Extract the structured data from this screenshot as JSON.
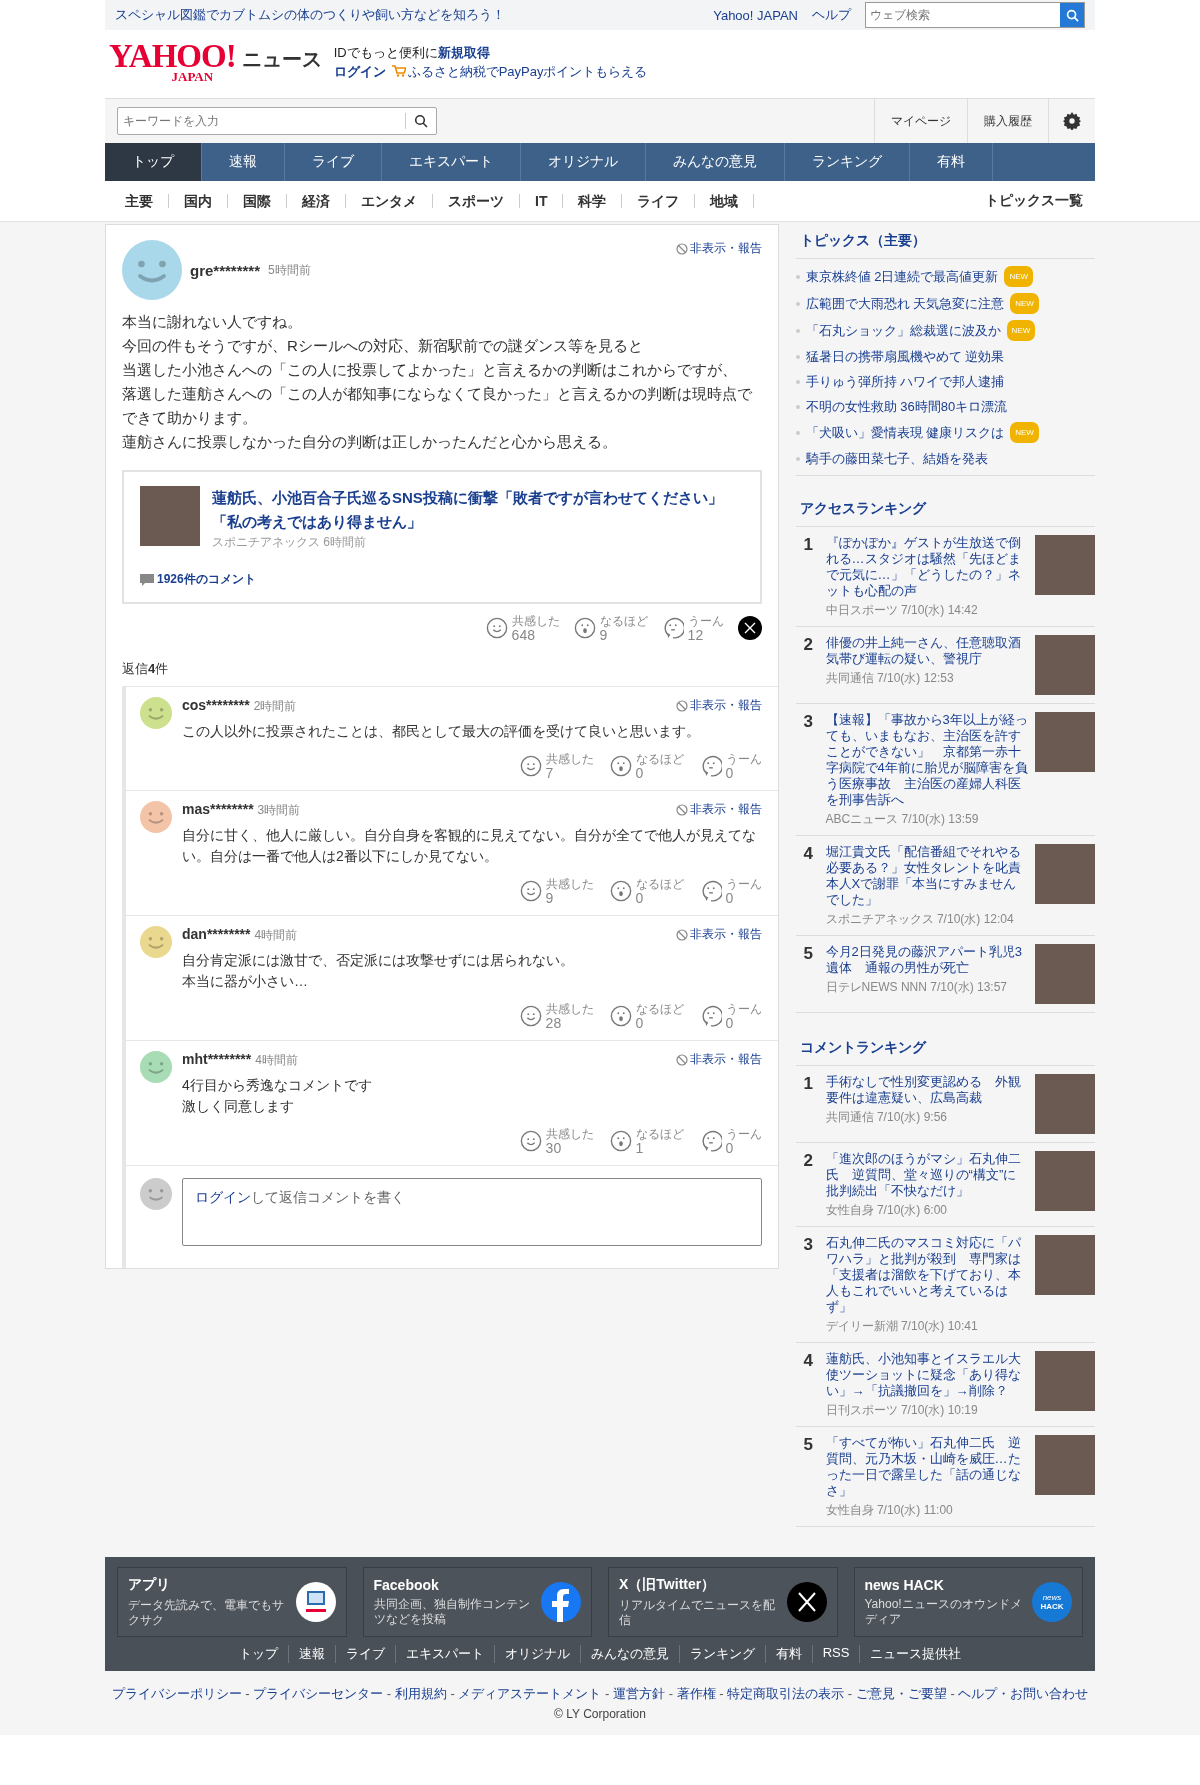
{
  "promo": "スペシャル図鑑でカブトムシの体のつくりや飼い方などを知ろう！",
  "header_links": [
    "Yahoo! JAPAN",
    "ヘルプ"
  ],
  "web_search": {
    "placeholder": "ウェブ検索"
  },
  "logo": {
    "main": "YAHOO!",
    "sub": "JAPAN"
  },
  "site_name": "ニュース",
  "id_promo": {
    "text": "IDでもっと便利に",
    "link": "新規取得"
  },
  "login": "ログイン",
  "furusato": "ふるさと納税でPayPayポイントもらえる",
  "search": {
    "placeholder": "キーワードを入力"
  },
  "user_links": [
    "マイページ",
    "購入履歴"
  ],
  "nav_tabs": [
    {
      "label": "トップ",
      "selected": true
    },
    {
      "label": "速報",
      "selected": false
    },
    {
      "label": "ライブ",
      "selected": false
    },
    {
      "label": "エキスパート",
      "selected": false
    },
    {
      "label": "オリジナル",
      "selected": false
    },
    {
      "label": "みんなの意見",
      "selected": false
    },
    {
      "label": "ランキング",
      "selected": false
    },
    {
      "label": "有料",
      "selected": false
    }
  ],
  "categories": [
    "主要",
    "国内",
    "国際",
    "経済",
    "エンタメ",
    "スポーツ",
    "IT",
    "科学",
    "ライフ",
    "地域"
  ],
  "topics_list_link": "トピックス一覧",
  "comment": {
    "user": "gre********",
    "time": "5時間前",
    "color": "#a8d8ea",
    "action": "非表示・報告",
    "body": [
      "本当に謝れない人ですね。",
      "今回の件もそうですが、Rシールへの対応、新宿駅前での謎ダンス等を見ると",
      "当選した小池さんへの「この人に投票してよかった」と言えるかの判断はこれからですが、",
      "落選した蓮舫さんへの「この人が都知事にならなくて良かった」と言えるかの判断は現時点でできて助かります。",
      "蓮舫さんに投票しなかった自分の判断は正しかったんだと心から思える。"
    ],
    "article": {
      "title": "蓮舫氏、小池百合子氏巡るSNS投稿に衝撃「敗者ですが言わせてください」「私の考えではあり得ません」",
      "source": "スポニチアネックス",
      "time": "6時間前",
      "comments": "1926件のコメント"
    },
    "reactions": [
      {
        "kind": "smile",
        "label": "共感した",
        "count": "648"
      },
      {
        "kind": "surprised",
        "label": "なるほど",
        "count": "9"
      },
      {
        "kind": "thinking",
        "label": "うーん",
        "count": "12"
      }
    ]
  },
  "replies_label": "返信**4**件",
  "replies": [
    {
      "user": "cos********",
      "time": "2時間前",
      "color": "#cde08e",
      "action": "非表示・報告",
      "body": [
        "この人以外に投票されたことは、都民として最大の評価を受けて良いと思います。"
      ],
      "reactions": [
        {
          "kind": "smile",
          "label": "共感した",
          "count": "7"
        },
        {
          "kind": "surprised",
          "label": "なるほど",
          "count": "0"
        },
        {
          "kind": "thinking",
          "label": "うーん",
          "count": "0"
        }
      ]
    },
    {
      "user": "mas********",
      "time": "3時間前",
      "color": "#f3c4a8",
      "action": "非表示・報告",
      "body": [
        "自分に甘く、他人に厳しい。自分自身を客観的に見えてない。自分が全てで他人が見えてない。自分は一番で他人は2番以下にしか見てない。"
      ],
      "reactions": [
        {
          "kind": "smile",
          "label": "共感した",
          "count": "9"
        },
        {
          "kind": "surprised",
          "label": "なるほど",
          "count": "0"
        },
        {
          "kind": "thinking",
          "label": "うーん",
          "count": "0"
        }
      ]
    },
    {
      "user": "dan********",
      "time": "4時間前",
      "color": "#ead88e",
      "action": "非表示・報告",
      "body": [
        "自分肯定派には激甘で、否定派には攻撃せずには居られない。",
        "本当に器が小さい…"
      ],
      "reactions": [
        {
          "kind": "smile",
          "label": "共感した",
          "count": "28"
        },
        {
          "kind": "surprised",
          "label": "なるほど",
          "count": "0"
        },
        {
          "kind": "thinking",
          "label": "うーん",
          "count": "0"
        }
      ]
    },
    {
      "user": "mht********",
      "time": "4時間前",
      "color": "#a8dcb4",
      "action": "非表示・報告",
      "body": [
        "4行目から秀逸なコメントです",
        "激しく同意します"
      ],
      "reactions": [
        {
          "kind": "smile",
          "label": "共感した",
          "count": "30"
        },
        {
          "kind": "surprised",
          "label": "なるほど",
          "count": "1"
        },
        {
          "kind": "thinking",
          "label": "うーん",
          "count": "0"
        }
      ]
    }
  ],
  "reply_box": {
    "link": "ログイン",
    "text": "して返信コメントを書く"
  },
  "topics": {
    "title": "トピックス（主要）",
    "items": [
      {
        "title": "東京株終値 2日連続で最高値更新",
        "badge": "NEW"
      },
      {
        "title": "広範囲で大雨恐れ 天気急変に注意",
        "badge": "NEW"
      },
      {
        "title": "「石丸ショック」総裁選に波及か",
        "badge": "NEW"
      },
      {
        "title": "猛暑日の携帯扇風機やめて 逆効果"
      },
      {
        "title": "手りゅう弾所持 ハワイで邦人逮捕"
      },
      {
        "title": "不明の女性救助 36時間80キロ漂流"
      },
      {
        "title": "「犬吸い」愛情表現 健康リスクは",
        "badge": "NEW"
      },
      {
        "title": "騎手の藤田菜七子、結婚を発表"
      }
    ]
  },
  "access_ranking": {
    "title": "アクセスランキング",
    "items": [
      {
        "rank": "1",
        "title": "『ぽかぽか』ゲストが生放送で倒れる…スタジオは騒然「先ほどまで元気に…」「どうしたの？」ネットも心配の声",
        "source": "中日スポーツ 7/10(水) 14:42"
      },
      {
        "rank": "2",
        "title": "俳優の井上純一さん、任意聴取酒気帯び運転の疑い、警視庁",
        "source": "共同通信 7/10(水) 12:53"
      },
      {
        "rank": "3",
        "title": "【速報】「事故から3年以上が経っても、いまもなお、主治医を許すことができない」　京都第一赤十字病院で4年前に胎児が脳障害を負う医療事故　主治医の産婦人科医を刑事告訴へ",
        "source": "ABCニュース 7/10(水) 13:59"
      },
      {
        "rank": "4",
        "title": "堀江貴文氏「配信番組でそれやる必要ある？」女性タレントを叱責本人Xで謝罪「本当にすみませんでした」",
        "source": "スポニチアネックス 7/10(水) 12:04"
      },
      {
        "rank": "5",
        "title": "今月2日発見の藤沢アパート乳児3遺体　通報の男性が死亡",
        "source": "日テレNEWS NNN 7/10(水) 13:57"
      }
    ]
  },
  "comment_ranking": {
    "title": "コメントランキング",
    "items": [
      {
        "rank": "1",
        "title": "手術なしで性別変更認める　外観要件は違憲疑い、広島高裁",
        "source": "共同通信 7/10(水) 9:56"
      },
      {
        "rank": "2",
        "title": "「進次郎のほうがマシ」石丸伸二氏　逆質問、堂々巡りの“構文”に批判続出「不快なだけ」",
        "source": "女性自身 7/10(水) 6:00"
      },
      {
        "rank": "3",
        "title": "石丸伸二氏のマスコミ対応に「パワハラ」と批判が殺到　専門家は「支援者は溜飲を下げており、本人もこれでいいと考えているはず」",
        "source": "デイリー新潮 7/10(水) 10:41"
      },
      {
        "rank": "4",
        "title": "蓮舫氏、小池知事とイスラエル大使ツーショットに疑念「あり得ない」→「抗議撤回を」→削除？",
        "source": "日刊スポーツ 7/10(水) 10:19"
      },
      {
        "rank": "5",
        "title": "「すべてが怖い」石丸伸二氏　逆質問、元乃木坂・山崎を威圧…たった一日で露呈した「話の通じなさ」",
        "source": "女性自身 7/10(水) 11:00"
      }
    ]
  },
  "footer_cards": [
    {
      "kind": "app",
      "title": "アプリ",
      "text": "データ先読みで、電車でもサクサク"
    },
    {
      "kind": "facebook",
      "title": "Facebook",
      "text": "共同企画、独自制作コンテンツなどを投稿"
    },
    {
      "kind": "x",
      "title": "X（旧Twitter）",
      "text": "リアルタイムでニュースを配信"
    },
    {
      "kind": "newshack",
      "title": "news HACK",
      "text": "Yahoo!ニュースのオウンドメディア",
      "icon_text": [
        "news",
        "HACK"
      ]
    }
  ],
  "footer_links": [
    "トップ",
    "速報",
    "ライブ",
    "エキスパート",
    "オリジナル",
    "みんなの意見",
    "ランキング",
    "有料",
    "RSS",
    "ニュース提供社"
  ],
  "legal_links": [
    "プライバシーポリシー",
    "プライバシーセンター",
    "利用規約",
    "メディアステートメント",
    "運営方針",
    "著作権",
    "特定商取引法の表示",
    "ご意見・ご要望",
    "ヘルプ・お問い合わせ"
  ],
  "legal_separator": "-",
  "copyright": "© LY Corporation"
}
